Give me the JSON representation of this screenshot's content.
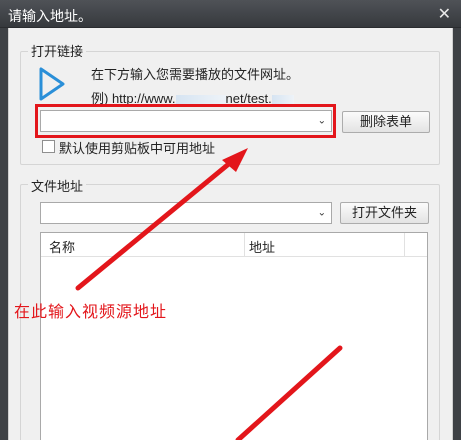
{
  "window": {
    "title": "请输入地址。",
    "close_glyph": "✕"
  },
  "open_link": {
    "group_label": "打开链接",
    "hint_line1": "在下方输入您需要播放的文件网址。",
    "hint_line2_prefix": "例) http://www.",
    "hint_line2_mid": "net/test.",
    "url_select_value": "",
    "clear_button": "删除表单",
    "clipboard_checkbox_label": "默认使用剪贴板中可用地址",
    "clipboard_checked": false
  },
  "file_address": {
    "group_label": "文件地址",
    "dir_select_value": "",
    "open_folder_button": "打开文件夹",
    "columns": [
      "名称",
      "地址"
    ]
  },
  "annotation": {
    "text": "在此输入视频源地址",
    "color": "#e3161b"
  },
  "icons": {
    "play": "play-triangle-icon",
    "dropdown": "chevron-down-icon"
  }
}
